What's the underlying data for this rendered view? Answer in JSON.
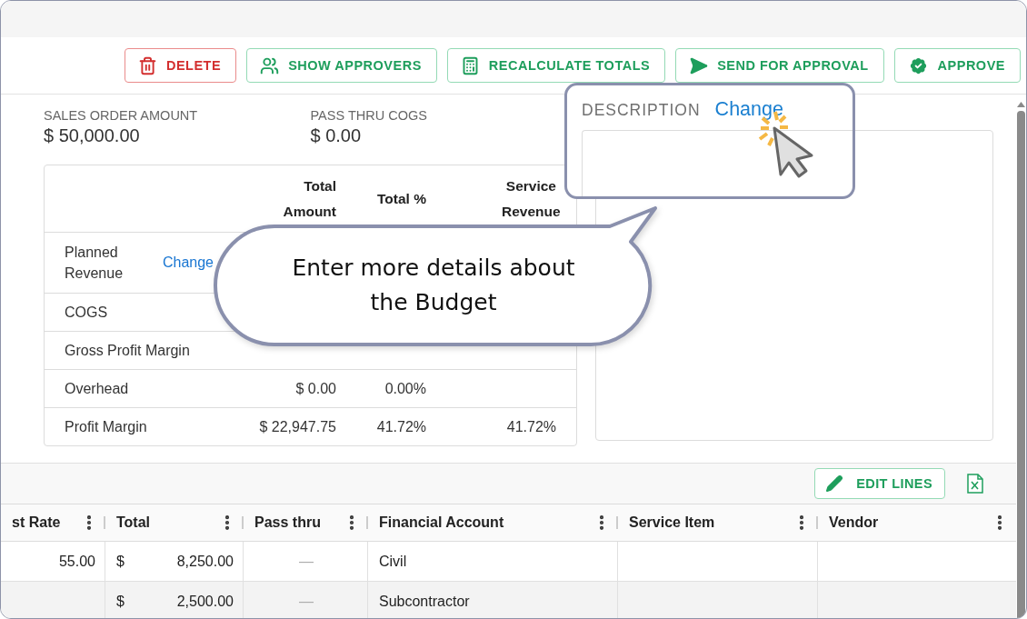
{
  "toolbar": {
    "buttons": [
      {
        "label": "DELETE",
        "kind": "delete"
      },
      {
        "label": "SHOW APPROVERS",
        "kind": "approvers"
      },
      {
        "label": "RECALCULATE TOTALS",
        "kind": "calculate"
      },
      {
        "label": "SEND FOR APPROVAL",
        "kind": "send"
      },
      {
        "label": "APPROVE",
        "kind": "approve"
      }
    ]
  },
  "summary": [
    {
      "label": "SALES ORDER AMOUNT",
      "value": "$ 50,000.00"
    },
    {
      "label": "PASS THRU COGS",
      "value": "$ 0.00"
    }
  ],
  "budget_table": {
    "columns": [
      "Total Amount",
      "Total %",
      "Service Revenue"
    ],
    "rows": [
      {
        "label": "Planned Revenue",
        "link": "Change",
        "cells": []
      },
      {
        "label": "COGS",
        "cells": []
      },
      {
        "label": "Gross Profit Margin",
        "cells": []
      },
      {
        "label": "Overhead",
        "cells": [
          "$ 0.00",
          "0.00%"
        ]
      },
      {
        "label": "Profit Margin",
        "cells": [
          "$ 22,947.75",
          "41.72%",
          "41.72%"
        ]
      }
    ]
  },
  "description": {
    "label": "DESCRIPTION",
    "link": "Change"
  },
  "callout": {
    "text": "Enter more details about the Budget"
  },
  "lines": {
    "edit_button": "EDIT LINES",
    "columns": [
      "st Rate",
      "Total",
      "Pass thru",
      "Financial Account",
      "Service Item",
      "Vendor"
    ],
    "rows": [
      {
        "highlighted": false,
        "cells": [
          {
            "kind": "number",
            "text": "55.00"
          },
          {
            "kind": "money",
            "currency": "$",
            "amount": "8,250.00"
          },
          {
            "kind": "dash",
            "text": "—"
          },
          {
            "kind": "text",
            "text": "Civil"
          },
          {
            "kind": "empty"
          },
          {
            "kind": "empty"
          }
        ]
      },
      {
        "highlighted": true,
        "cells": [
          {
            "kind": "empty"
          },
          {
            "kind": "money",
            "currency": "$",
            "amount": "2,500.00"
          },
          {
            "kind": "dash",
            "text": "—"
          },
          {
            "kind": "text",
            "text": "Subcontractor"
          },
          {
            "kind": "empty"
          },
          {
            "kind": "empty"
          }
        ]
      }
    ]
  }
}
